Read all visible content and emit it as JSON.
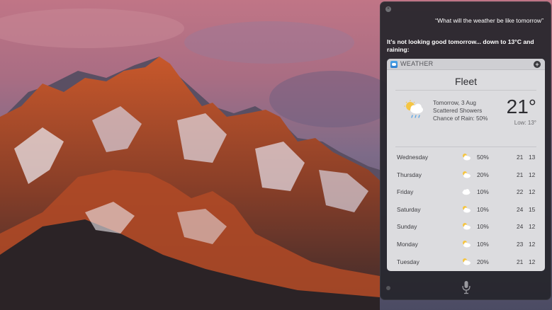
{
  "siri": {
    "query": "“What will the weather be like tomorrow”",
    "answer": "It’s not looking good tomorrow... down to 13°C and raining:",
    "close_icon": "close-icon",
    "mic_icon": "microphone-icon"
  },
  "weather": {
    "app_name": "WEATHER",
    "add_label": "+",
    "city": "Fleet",
    "summary": {
      "line1": "Tomorrow, 3 Aug",
      "line2": "Scattered Showers",
      "line3": "Chance of Rain: 50%",
      "icon": "scattered-showers-icon"
    },
    "temp": "21°",
    "low": "Low: 13°",
    "days": [
      {
        "day": "Wednesday",
        "rain": "50%",
        "hi": "21",
        "lo": "13",
        "icon": "partly-cloudy-icon"
      },
      {
        "day": "Thursday",
        "rain": "20%",
        "hi": "21",
        "lo": "12",
        "icon": "partly-cloudy-icon"
      },
      {
        "day": "Friday",
        "rain": "10%",
        "hi": "22",
        "lo": "12",
        "icon": "cloudy-icon"
      },
      {
        "day": "Saturday",
        "rain": "10%",
        "hi": "24",
        "lo": "15",
        "icon": "partly-cloudy-icon"
      },
      {
        "day": "Sunday",
        "rain": "10%",
        "hi": "24",
        "lo": "12",
        "icon": "partly-cloudy-icon"
      },
      {
        "day": "Monday",
        "rain": "10%",
        "hi": "23",
        "lo": "12",
        "icon": "partly-cloudy-icon"
      },
      {
        "day": "Tuesday",
        "rain": "20%",
        "hi": "21",
        "lo": "12",
        "icon": "partly-cloudy-icon"
      }
    ]
  },
  "colors": {
    "panel": "#26262c",
    "card": "#dcdcdf",
    "sun": "#f5c542"
  }
}
